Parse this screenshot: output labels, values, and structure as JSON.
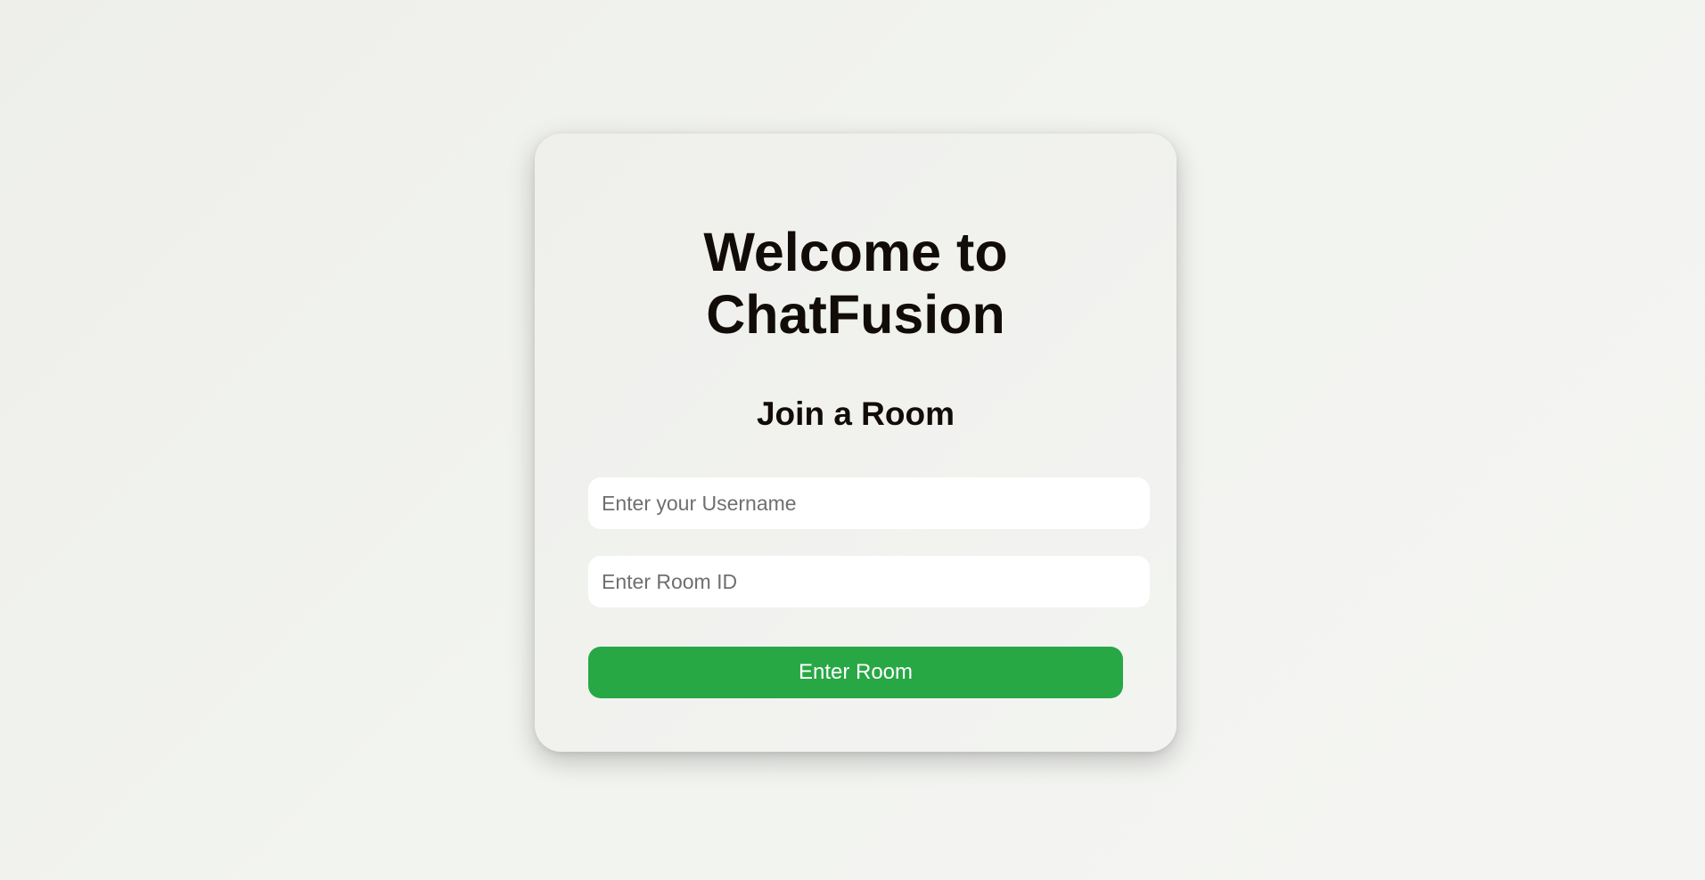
{
  "card": {
    "title_line1": "Welcome to",
    "title_line2": "ChatFusion",
    "subtitle": "Join a Room",
    "username_placeholder": "Enter your Username",
    "username_value": "",
    "room_placeholder": "Enter Room ID",
    "room_value": "",
    "button_label": "Enter Room"
  },
  "colors": {
    "accent": "#28a745",
    "text": "#120c08",
    "background": "#f1f2ef"
  }
}
